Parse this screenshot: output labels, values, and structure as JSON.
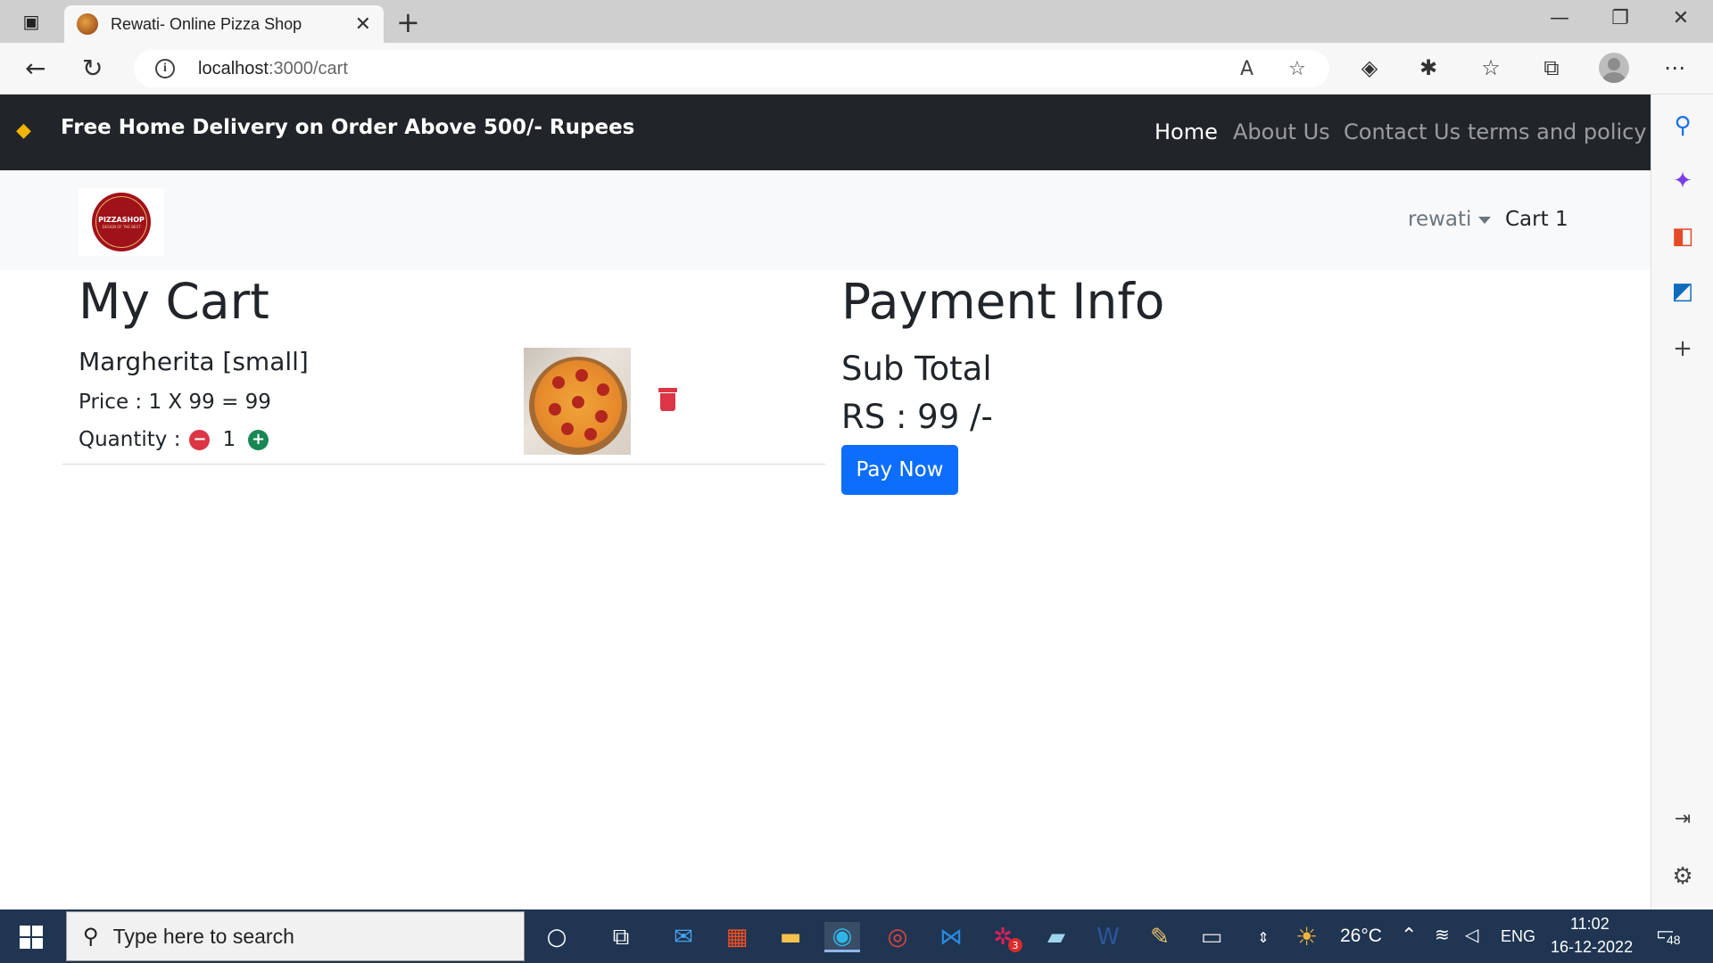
{
  "browser": {
    "tab_title": "Rewati- Online Pizza Shop",
    "url_host": "localhost",
    "url_path": ":3000/cart"
  },
  "topbar": {
    "promo": "Free Home Delivery on Order Above 500/- Rupees",
    "nav": [
      "Home",
      "About Us",
      "Contact Us",
      "terms and policy"
    ]
  },
  "navbar": {
    "logo_name": "PIZZASHOP",
    "logo_tagline": "DESIGN OF THE BEST",
    "user": "rewati",
    "cart": "Cart 1"
  },
  "cart": {
    "heading": "My Cart",
    "items": [
      {
        "name": "Margherita [small]",
        "price_line": "Price : 1 X 99 = 99",
        "qty_label": "Quantity :",
        "qty": "1"
      }
    ]
  },
  "payment": {
    "heading": "Payment Info",
    "subtotal_label": "Sub Total",
    "subtotal_value": "RS : 99 /-",
    "pay_button": "Pay Now"
  },
  "taskbar": {
    "search_placeholder": "Type here to search",
    "slack_badge": "3",
    "weather": "26°C",
    "lang": "ENG",
    "time": "11:02",
    "date": "16-12-2022",
    "notifications": "48"
  },
  "colors": {
    "topbar_bg": "#212529",
    "pay_button": "#0d6efd",
    "danger": "#dc3545",
    "success": "#198754"
  }
}
